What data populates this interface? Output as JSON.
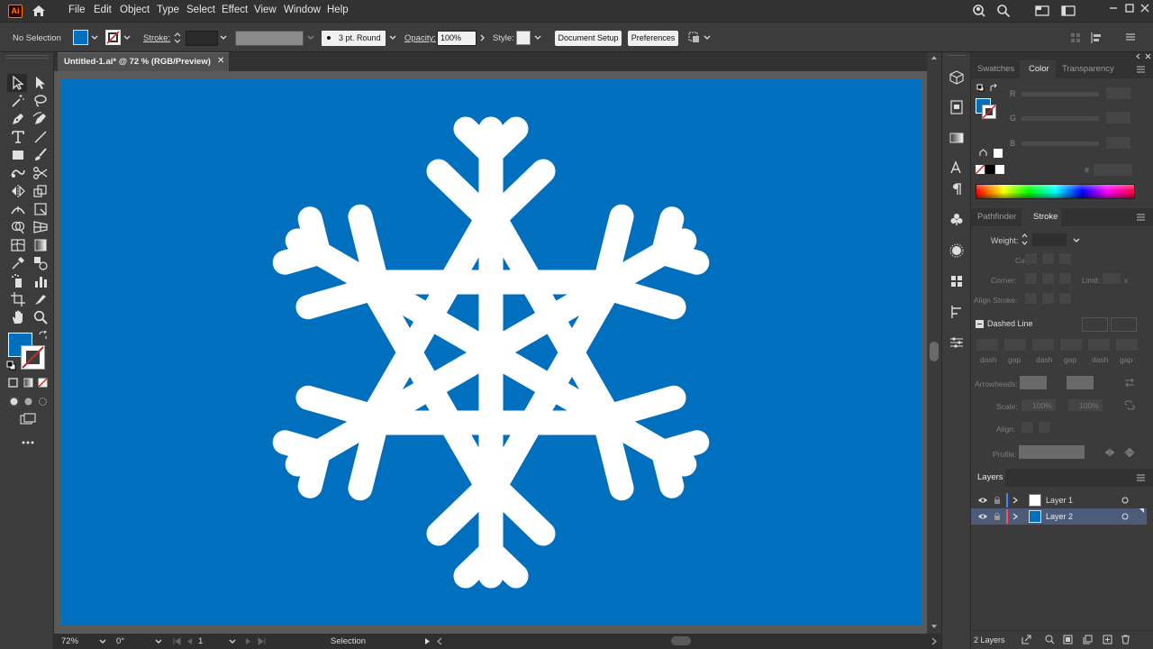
{
  "menubar": {
    "app_badge": "Ai",
    "items": [
      "File",
      "Edit",
      "Object",
      "Type",
      "Select",
      "Effect",
      "View",
      "Window",
      "Help"
    ]
  },
  "control": {
    "selection": "No Selection",
    "stroke_label": "Stroke:",
    "brush": "3 pt. Round",
    "opacity_label": "Opacity:",
    "opacity_value": "100%",
    "style_label": "Style:",
    "document_setup": "Document Setup",
    "preferences": "Preferences"
  },
  "document": {
    "tab_title": "Untitled-1.ai* @ 72 % (RGB/Preview)",
    "close": "✕",
    "background_color": "#0070be",
    "snowflake_color": "#ffffff"
  },
  "status": {
    "zoom": "72%",
    "rotation": "0°",
    "artboard_number": "1",
    "tool": "Selection"
  },
  "color_panel": {
    "tabs": [
      "Swatches",
      "Color",
      "Transparency"
    ],
    "channels": [
      "R",
      "G",
      "B"
    ],
    "hex_label": "#"
  },
  "stroke_panel": {
    "tabs": [
      "Pathfinder",
      "Stroke"
    ],
    "weight_label": "Weight:",
    "cap_label": "Cap:",
    "corner_label": "Corner:",
    "limit_label": "Limit:",
    "limit_unit": "x",
    "align_label": "Align Stroke:",
    "dashed_label": "Dashed Line",
    "dash_labels": [
      "dash",
      "gap",
      "dash",
      "gap",
      "dash",
      "gap"
    ],
    "arrowheads_label": "Arrowheads:",
    "scale_label": "Scale:",
    "scale_value_1": "100%",
    "scale_value_2": "100%",
    "align_arrow_label": "Align:",
    "profile_label": "Profile:"
  },
  "layers_panel": {
    "title": "Layers",
    "layers": [
      {
        "name": "Layer 1",
        "color": "#4f7fff"
      },
      {
        "name": "Layer 2",
        "color": "#ff4f4f"
      }
    ],
    "count": "2 Layers"
  }
}
